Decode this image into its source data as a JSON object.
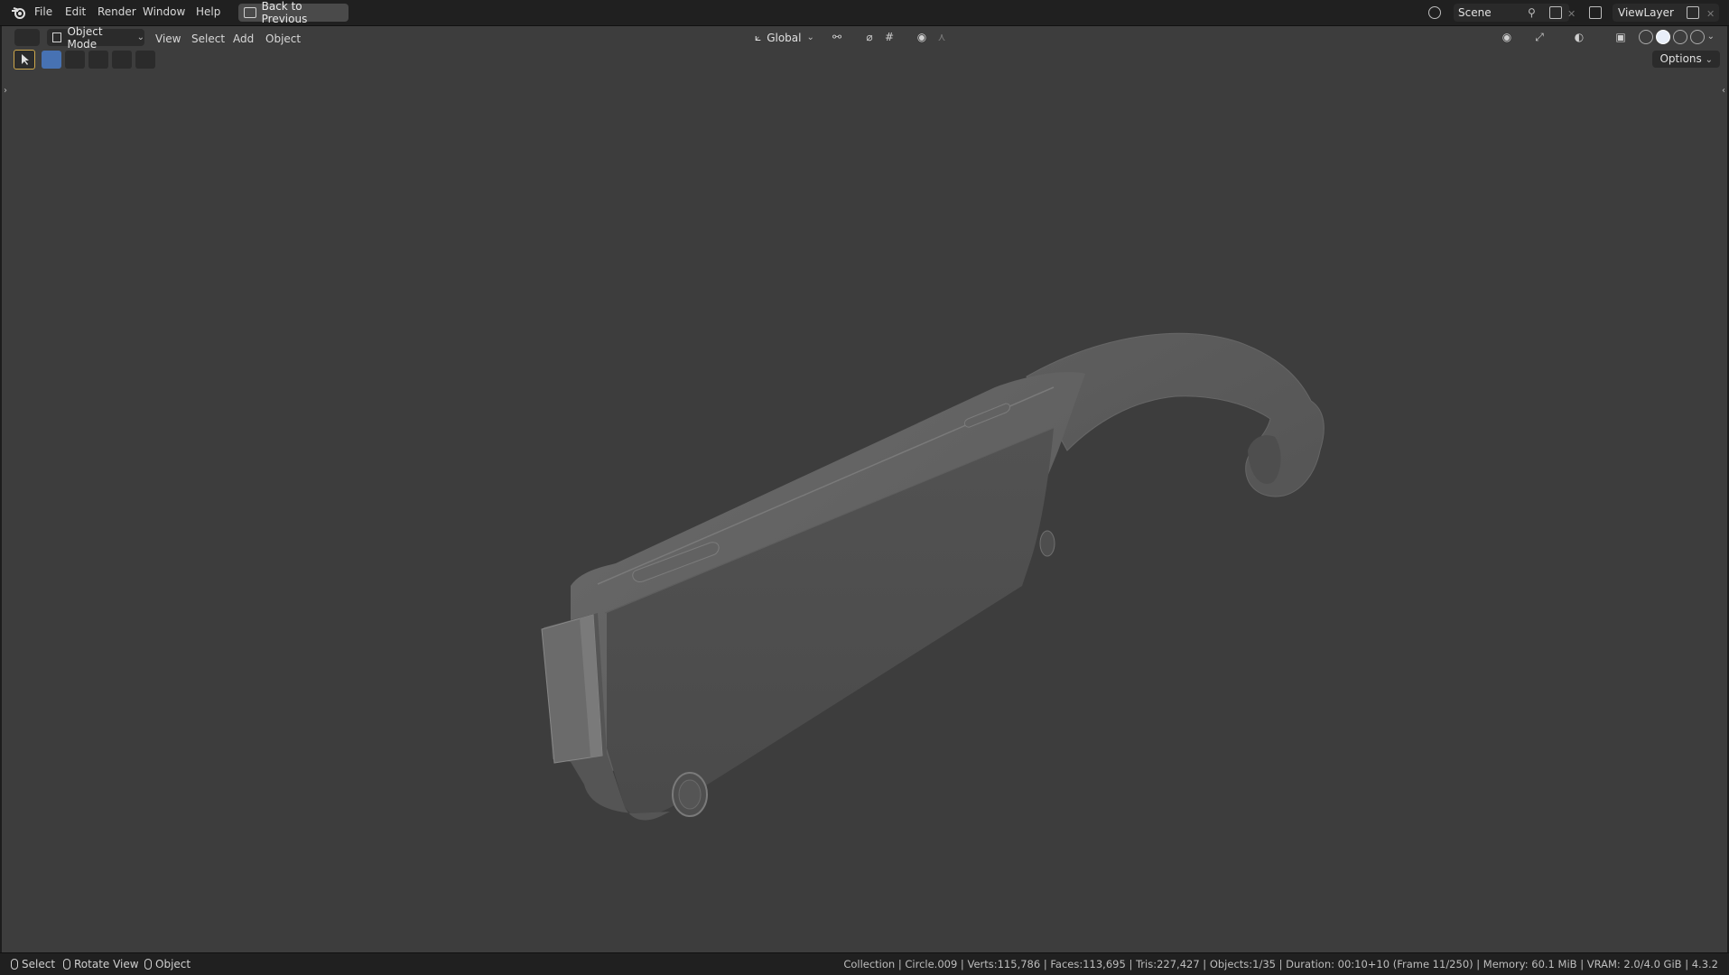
{
  "menubar": {
    "items": [
      "File",
      "Edit",
      "Render",
      "Window",
      "Help"
    ],
    "back_button": "Back to Previous",
    "scene": "Scene",
    "view_layer": "ViewLayer"
  },
  "viewport_header": {
    "mode": "Object Mode",
    "menus": [
      "View",
      "Select",
      "Add",
      "Object"
    ],
    "orientation": "Global",
    "options_label": "Options"
  },
  "statusbar": {
    "hints": [
      "Select",
      "Rotate View",
      "Object"
    ],
    "stats": "Collection | Circle.009 | Verts:115,786 | Faces:113,695 | Tris:227,427 | Objects:1/35 | Duration: 00:10+10 (Frame 11/250) | Memory: 60.1 MiB | VRAM: 2.0/4.0 GiB | 4.3.2"
  },
  "colors": {
    "viewport_bg": "#3d3d3d",
    "accent": "#4772b3",
    "active_tool": "#cfa84b"
  }
}
